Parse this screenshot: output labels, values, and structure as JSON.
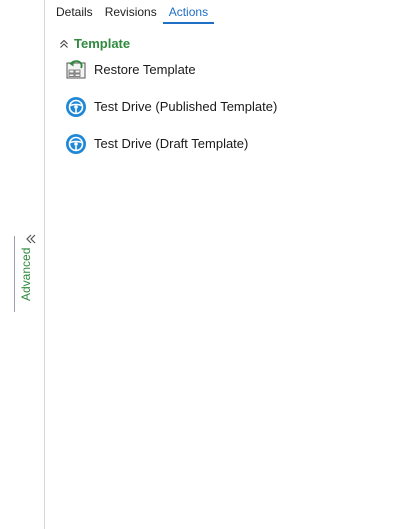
{
  "tabs": [
    {
      "label": "Details",
      "active": false
    },
    {
      "label": "Revisions",
      "active": false
    },
    {
      "label": "Actions",
      "active": true
    }
  ],
  "section": {
    "title": "Template",
    "collapse_icon": "double-chevron-up-icon",
    "title_color": "#2f8a3e"
  },
  "actions": [
    {
      "label": "Restore Template",
      "icon": "restore-template-icon"
    },
    {
      "label": "Test Drive (Published Template)",
      "icon": "steering-wheel-icon"
    },
    {
      "label": "Test Drive (Draft Template)",
      "icon": "steering-wheel-icon"
    }
  ],
  "advanced_panel": {
    "label": "Advanced",
    "toggle_icon": "double-chevron-left-icon",
    "label_color": "#2f8a3e"
  },
  "colors": {
    "active_tab": "#1f6fc5",
    "accent_green": "#2f8a3e",
    "icon_blue": "#1e88d6"
  }
}
